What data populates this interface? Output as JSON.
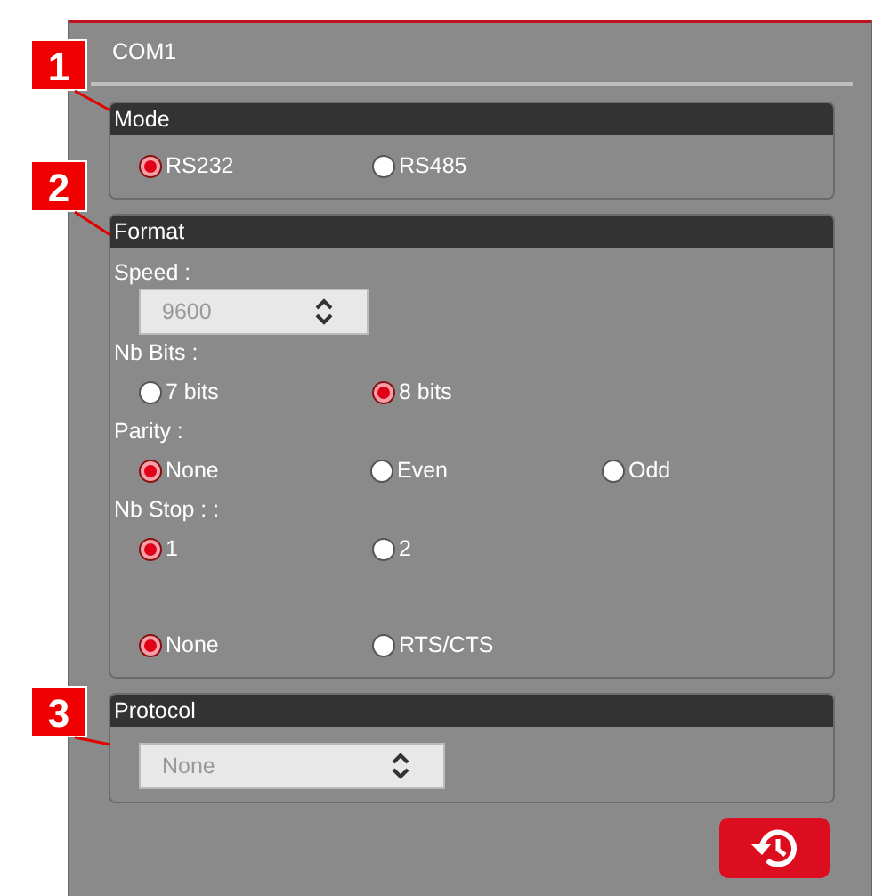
{
  "panel": {
    "title": "COM1"
  },
  "annotations": [
    {
      "label": "1"
    },
    {
      "label": "2"
    },
    {
      "label": "3"
    }
  ],
  "sections": [
    {
      "title": "Mode",
      "groups": [
        {
          "kind": "radios",
          "options": [
            {
              "label": "RS232",
              "selected": true
            },
            {
              "label": "RS485",
              "selected": false
            }
          ]
        }
      ]
    },
    {
      "title": "Format",
      "groups": [
        {
          "kind": "select",
          "label": "Speed :",
          "value": "9600"
        },
        {
          "kind": "radios",
          "label": "Nb Bits :",
          "options": [
            {
              "label": "7 bits",
              "selected": false
            },
            {
              "label": "8 bits",
              "selected": true
            }
          ]
        },
        {
          "kind": "radios",
          "label": "Parity :",
          "options": [
            {
              "label": "None",
              "selected": true
            },
            {
              "label": "Even",
              "selected": false
            },
            {
              "label": "Odd",
              "selected": false
            }
          ]
        },
        {
          "kind": "radios",
          "label": "Nb Stop : :",
          "options": [
            {
              "label": "1",
              "selected": true
            },
            {
              "label": "2",
              "selected": false
            }
          ]
        },
        {
          "kind": "radios",
          "options": [
            {
              "label": "None",
              "selected": true
            },
            {
              "label": "RTS/CTS",
              "selected": false
            }
          ]
        }
      ]
    },
    {
      "title": "Protocol",
      "groups": [
        {
          "kind": "select",
          "value": "None"
        }
      ]
    }
  ]
}
